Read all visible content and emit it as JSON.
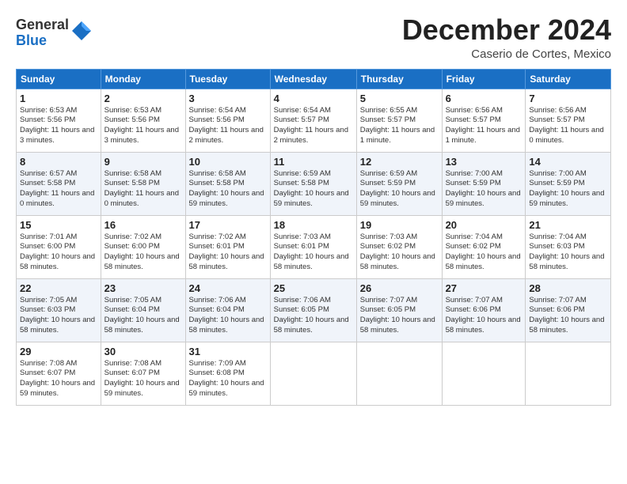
{
  "header": {
    "logo_general": "General",
    "logo_blue": "Blue",
    "title": "December 2024",
    "location": "Caserio de Cortes, Mexico"
  },
  "weekdays": [
    "Sunday",
    "Monday",
    "Tuesday",
    "Wednesday",
    "Thursday",
    "Friday",
    "Saturday"
  ],
  "weeks": [
    [
      {
        "day": "1",
        "sunrise": "6:53 AM",
        "sunset": "5:56 PM",
        "daylight": "11 hours and 3 minutes."
      },
      {
        "day": "2",
        "sunrise": "6:53 AM",
        "sunset": "5:56 PM",
        "daylight": "11 hours and 3 minutes."
      },
      {
        "day": "3",
        "sunrise": "6:54 AM",
        "sunset": "5:56 PM",
        "daylight": "11 hours and 2 minutes."
      },
      {
        "day": "4",
        "sunrise": "6:54 AM",
        "sunset": "5:57 PM",
        "daylight": "11 hours and 2 minutes."
      },
      {
        "day": "5",
        "sunrise": "6:55 AM",
        "sunset": "5:57 PM",
        "daylight": "11 hours and 1 minute."
      },
      {
        "day": "6",
        "sunrise": "6:56 AM",
        "sunset": "5:57 PM",
        "daylight": "11 hours and 1 minute."
      },
      {
        "day": "7",
        "sunrise": "6:56 AM",
        "sunset": "5:57 PM",
        "daylight": "11 hours and 0 minutes."
      }
    ],
    [
      {
        "day": "8",
        "sunrise": "6:57 AM",
        "sunset": "5:58 PM",
        "daylight": "11 hours and 0 minutes."
      },
      {
        "day": "9",
        "sunrise": "6:58 AM",
        "sunset": "5:58 PM",
        "daylight": "11 hours and 0 minutes."
      },
      {
        "day": "10",
        "sunrise": "6:58 AM",
        "sunset": "5:58 PM",
        "daylight": "10 hours and 59 minutes."
      },
      {
        "day": "11",
        "sunrise": "6:59 AM",
        "sunset": "5:58 PM",
        "daylight": "10 hours and 59 minutes."
      },
      {
        "day": "12",
        "sunrise": "6:59 AM",
        "sunset": "5:59 PM",
        "daylight": "10 hours and 59 minutes."
      },
      {
        "day": "13",
        "sunrise": "7:00 AM",
        "sunset": "5:59 PM",
        "daylight": "10 hours and 59 minutes."
      },
      {
        "day": "14",
        "sunrise": "7:00 AM",
        "sunset": "5:59 PM",
        "daylight": "10 hours and 59 minutes."
      }
    ],
    [
      {
        "day": "15",
        "sunrise": "7:01 AM",
        "sunset": "6:00 PM",
        "daylight": "10 hours and 58 minutes."
      },
      {
        "day": "16",
        "sunrise": "7:02 AM",
        "sunset": "6:00 PM",
        "daylight": "10 hours and 58 minutes."
      },
      {
        "day": "17",
        "sunrise": "7:02 AM",
        "sunset": "6:01 PM",
        "daylight": "10 hours and 58 minutes."
      },
      {
        "day": "18",
        "sunrise": "7:03 AM",
        "sunset": "6:01 PM",
        "daylight": "10 hours and 58 minutes."
      },
      {
        "day": "19",
        "sunrise": "7:03 AM",
        "sunset": "6:02 PM",
        "daylight": "10 hours and 58 minutes."
      },
      {
        "day": "20",
        "sunrise": "7:04 AM",
        "sunset": "6:02 PM",
        "daylight": "10 hours and 58 minutes."
      },
      {
        "day": "21",
        "sunrise": "7:04 AM",
        "sunset": "6:03 PM",
        "daylight": "10 hours and 58 minutes."
      }
    ],
    [
      {
        "day": "22",
        "sunrise": "7:05 AM",
        "sunset": "6:03 PM",
        "daylight": "10 hours and 58 minutes."
      },
      {
        "day": "23",
        "sunrise": "7:05 AM",
        "sunset": "6:04 PM",
        "daylight": "10 hours and 58 minutes."
      },
      {
        "day": "24",
        "sunrise": "7:06 AM",
        "sunset": "6:04 PM",
        "daylight": "10 hours and 58 minutes."
      },
      {
        "day": "25",
        "sunrise": "7:06 AM",
        "sunset": "6:05 PM",
        "daylight": "10 hours and 58 minutes."
      },
      {
        "day": "26",
        "sunrise": "7:07 AM",
        "sunset": "6:05 PM",
        "daylight": "10 hours and 58 minutes."
      },
      {
        "day": "27",
        "sunrise": "7:07 AM",
        "sunset": "6:06 PM",
        "daylight": "10 hours and 58 minutes."
      },
      {
        "day": "28",
        "sunrise": "7:07 AM",
        "sunset": "6:06 PM",
        "daylight": "10 hours and 58 minutes."
      }
    ],
    [
      {
        "day": "29",
        "sunrise": "7:08 AM",
        "sunset": "6:07 PM",
        "daylight": "10 hours and 59 minutes."
      },
      {
        "day": "30",
        "sunrise": "7:08 AM",
        "sunset": "6:07 PM",
        "daylight": "10 hours and 59 minutes."
      },
      {
        "day": "31",
        "sunrise": "7:09 AM",
        "sunset": "6:08 PM",
        "daylight": "10 hours and 59 minutes."
      },
      null,
      null,
      null,
      null
    ]
  ],
  "labels": {
    "sunrise": "Sunrise: ",
    "sunset": "Sunset: ",
    "daylight": "Daylight: "
  }
}
